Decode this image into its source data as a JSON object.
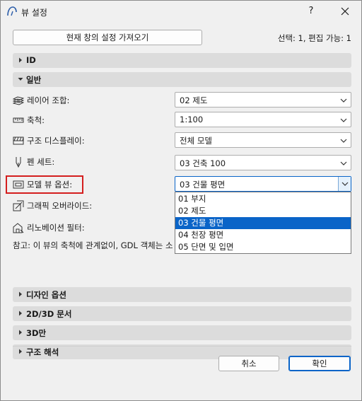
{
  "window": {
    "title": "뷰 설정",
    "help_label": "?",
    "close_icon": "close-icon"
  },
  "top": {
    "import_button": "현재 창의 설정 가져오기",
    "selection_info": "선택: 1, 편집 가능: 1"
  },
  "sections": {
    "id": "ID",
    "general": "일반",
    "design_options": "디자인 옵션",
    "docs_2d3d": "2D/3D 문서",
    "only_3d": "3D만",
    "structural_analysis": "구조 해석"
  },
  "general": {
    "layer_combo": {
      "label": "레이어 조합:",
      "value": "02 제도",
      "icon": "layers-icon"
    },
    "scale": {
      "label": "축척:",
      "value": "1:100",
      "icon": "ruler-icon"
    },
    "structure_display": {
      "label": "구조 디스플레이:",
      "value": "전체 모델",
      "icon": "structure-display-icon"
    },
    "pen_set": {
      "label": "펜 세트:",
      "value": "03 건축 100",
      "icon": "pen-icon"
    },
    "model_view_options": {
      "label": "모델 뷰 옵션:",
      "value": "03 건물 평면",
      "icon": "model-view-icon"
    },
    "graphic_override": {
      "label": "그래픽 오버라이드:",
      "icon": "graphic-override-icon"
    },
    "renovation_filter": {
      "label": "리노베이션 필터:",
      "icon": "renovation-icon"
    },
    "note": "참고: 이 뷰의 축척에 관계없이, GDL 객체는 소"
  },
  "dropdown": {
    "options": [
      "01 부지",
      "02 제도",
      "03 건물 평면",
      "04 천장 평면",
      "05 단면 및 입면"
    ],
    "selected_index": 2
  },
  "footer": {
    "cancel": "취소",
    "ok": "확인"
  },
  "colors": {
    "accent": "#0a64c8",
    "highlight_border": "#d41e1e",
    "section_bg": "#dcdcdc",
    "dialog_bg": "#f0f0f0"
  }
}
